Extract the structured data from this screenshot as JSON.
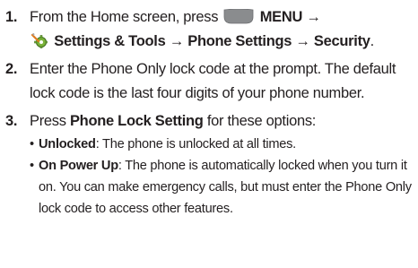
{
  "steps": [
    {
      "number": "1.",
      "line1_prefix": "From the Home screen, press",
      "menu_key_icon": "menu-key-icon",
      "menu_label": "MENU →",
      "settings_icon": "settings-tools-icon",
      "path_settings": "Settings & Tools",
      "arrow1": " → ",
      "path_phone": "Phone Settings",
      "arrow2": " → ",
      "path_security": "Security",
      "end": "."
    },
    {
      "number": "2.",
      "text": "Enter the Phone Only lock code at the prompt. The default lock code is the last four digits of your phone number."
    },
    {
      "number": "3.",
      "prefix": "Press ",
      "bold": "Phone Lock Setting",
      "suffix": " for these options:",
      "options": [
        {
          "bullet": "•",
          "name": "Unlocked",
          "desc": ": The phone is unlocked at all times."
        },
        {
          "bullet": "•",
          "name": "On Power Up",
          "desc": ": The phone is automatically locked when you turn it on. You can make emergency calls, but must enter the Phone Only lock code to access other features."
        }
      ]
    }
  ],
  "colors": {
    "text": "#231f20",
    "menu_key_fill": "#8a8c8e",
    "icon_green": "#4a8a2a",
    "icon_orange": "#e07b1f"
  }
}
